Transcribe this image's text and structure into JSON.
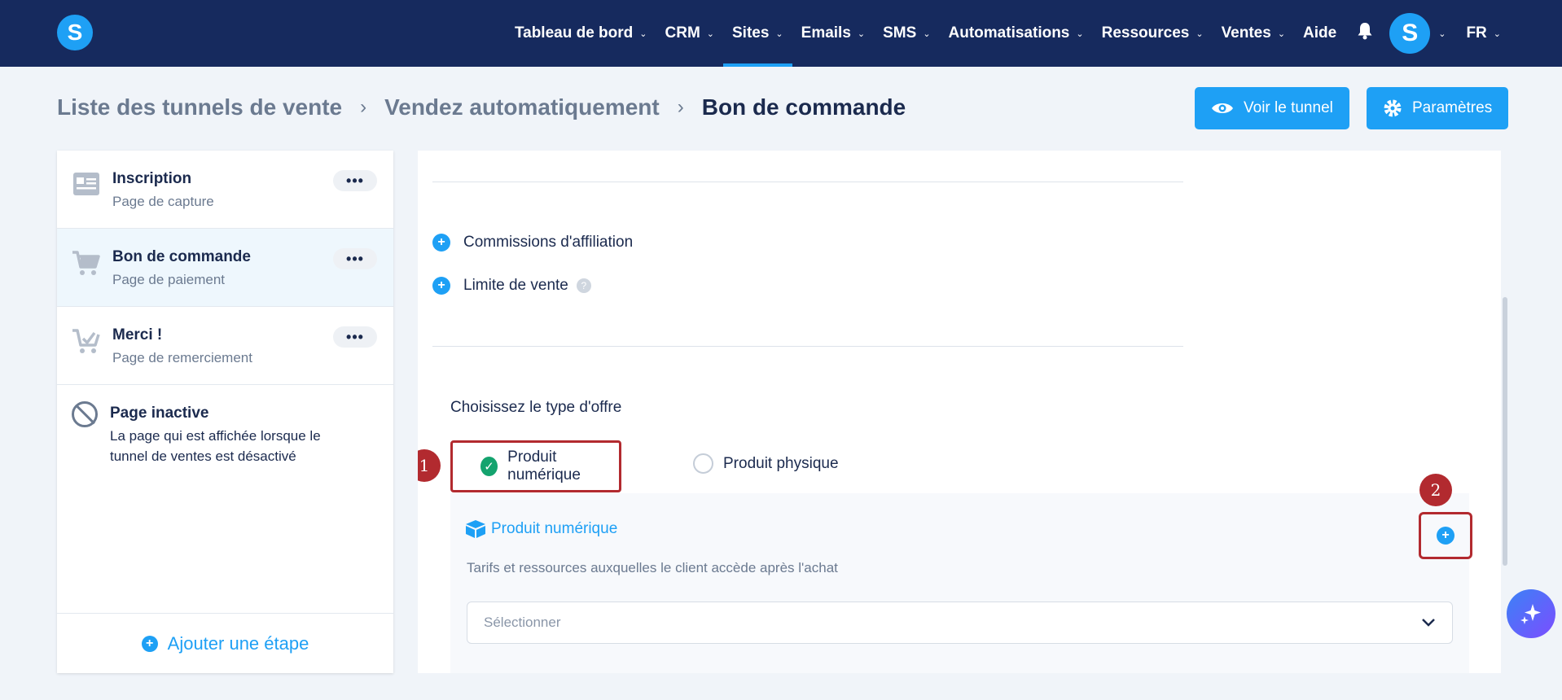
{
  "nav": {
    "logo_letter": "S",
    "items": [
      {
        "label": "Tableau de bord",
        "chevron": "⌄"
      },
      {
        "label": "CRM",
        "chevron": "⌄"
      },
      {
        "label": "Sites",
        "chevron": "⌄"
      },
      {
        "label": "Emails",
        "chevron": "⌄"
      },
      {
        "label": "SMS",
        "chevron": "⌄"
      },
      {
        "label": "Automatisations",
        "chevron": "⌄"
      },
      {
        "label": "Ressources",
        "chevron": "⌄"
      },
      {
        "label": "Ventes",
        "chevron": "⌄"
      },
      {
        "label": "Aide"
      }
    ],
    "active_item": "Sites",
    "avatar_letter": "S",
    "language": "FR"
  },
  "breadcrumb": {
    "level1": "Liste des tunnels de vente",
    "level2": "Vendez automatiquement",
    "current": "Bon de commande",
    "separator": "›"
  },
  "header_buttons": {
    "view_funnel": "Voir le tunnel",
    "settings": "Paramètres"
  },
  "steps": [
    {
      "title": "Inscription",
      "subtitle": "Page de capture",
      "icon": "form-icon",
      "menu": "•••"
    },
    {
      "title": "Bon de commande",
      "subtitle": "Page de paiement",
      "icon": "cart-icon",
      "menu": "•••",
      "active": true
    },
    {
      "title": "Merci !",
      "subtitle": "Page de remerciement",
      "icon": "cart-check-icon",
      "menu": "•••"
    }
  ],
  "inactive_page": {
    "title": "Page inactive",
    "description": "La page qui est affichée lorsque le tunnel de ventes est désactivé"
  },
  "add_step_label": "Ajouter une étape",
  "options": {
    "affiliate": "Commissions d'affiliation",
    "sales_limit": "Limite de vente",
    "help_glyph": "?"
  },
  "offer": {
    "label": "Choisissez le type d'offre",
    "digital": "Produit numérique",
    "physical": "Produit physique",
    "selected": "Produit numérique"
  },
  "annotations": {
    "badge1": "1",
    "badge2": "2"
  },
  "product_card": {
    "title": "Produit numérique",
    "description": "Tarifs et ressources auxquelles le client accède après l'achat",
    "select_placeholder": "Sélectionner"
  },
  "colors": {
    "nav_bg": "#162a5e",
    "accent": "#1ea0f5",
    "success": "#14a36e",
    "annotation_red": "#b22a2f",
    "page_bg": "#f0f4f9"
  }
}
